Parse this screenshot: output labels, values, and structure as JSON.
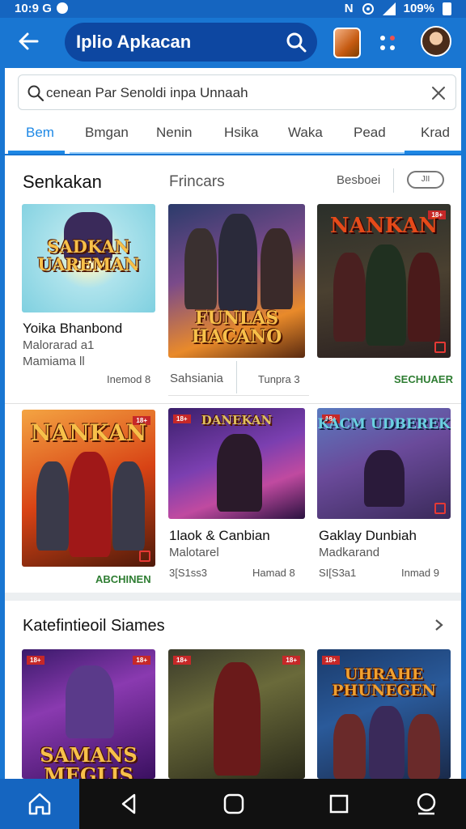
{
  "status_bar": {
    "time": "10:9 G",
    "carrier": "N",
    "battery": "109%"
  },
  "app_bar": {
    "title": "Iplio Apkacan"
  },
  "search": {
    "value": "cenean  Par Senoldi inpa Unnaah"
  },
  "tabs": [
    {
      "label": "Bem",
      "active": true
    },
    {
      "label": "Bmgan",
      "active": false
    },
    {
      "label": "Nenin",
      "active": false
    },
    {
      "label": "Hsika",
      "active": false
    },
    {
      "label": "Waka",
      "active": false
    },
    {
      "label": "Pead",
      "active": false
    },
    {
      "label": "Krad",
      "active": false
    }
  ],
  "section1": {
    "title": "Senkakan",
    "subtitle": "Frincars",
    "sort_label": "Besboei",
    "toggle_label": "JII",
    "cards": [
      {
        "art_title": "SADKAN UAREMAN",
        "name": "Yoika Bhanbond",
        "sub": "Malorarad a1",
        "sub2": "Mamiama ll",
        "meta": "Inemod 8"
      },
      {
        "art_title": "FUNLAS HACANO",
        "name": "",
        "sub": "Sahsiania",
        "sub2": "",
        "meta": "Tunpra 3"
      },
      {
        "art_title": "NANKAN",
        "name": "",
        "sub": "",
        "sub2": "",
        "meta": "",
        "action": "SECHUAER"
      },
      {
        "art_title": "NANKAN",
        "name": "",
        "sub": "",
        "sub2": "",
        "meta": "",
        "action": "ABCHINEN"
      },
      {
        "art_title": "DANEKAN",
        "name": "1laok & Canbian",
        "sub": "Malotarel",
        "sub2": "3[S1ss3",
        "meta": "Hamad 8"
      },
      {
        "art_title": "KACM UDBEREK",
        "name": "Gaklay Dunbiah",
        "sub": "Madkarand",
        "sub2": "SI[S3a1",
        "meta": "Inmad 9"
      }
    ]
  },
  "section2": {
    "title": "Katefintieoil Siames",
    "cards": [
      {
        "art_title": "SAMANS MEGLIS"
      },
      {
        "art_title": ""
      },
      {
        "art_title": "UHRAHE PHUNEGEN"
      }
    ]
  },
  "colors": {
    "primary": "#1976d2",
    "primary_dark": "#0d47a1",
    "accent": "#1e88e5",
    "action_green": "#2e7d32"
  }
}
